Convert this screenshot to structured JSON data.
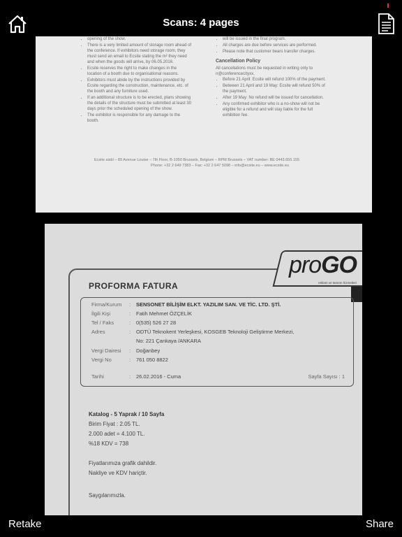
{
  "header": {
    "title": "Scans: 4 pages",
    "home_icon": "home-icon",
    "document_icon": "document-icon"
  },
  "footer": {
    "retake_label": "Retake",
    "share_label": "Share"
  },
  "page1": {
    "left_items": [
      "opening of the show.",
      "There is a very limited amount of storage room ahead of the conference. If exhibitors need storage room, they must send an email to Ecsite stating the m² they need and when the goods will arrive, by 06.05.2016.",
      "Ecsite reserves the right to make changes in the location of a booth due to organisational reasons.",
      "Exhibitors must abide by the instructions provided by Ecsite regarding the construction, maintenance, etc. of the booth and any furniture used.",
      "If an additional structure is to be erected, plans showing the details of the structure must be submitted at least 30 days prior the scheduled opening of the show.",
      "The exhibitor is responsible for any damage to the booth."
    ],
    "right_items_top": [
      "will be issued in the final program.",
      "All charges are due before services are performed.",
      "Please note that customer bears transfer charges."
    ],
    "cancellation_heading": "Cancellation Policy",
    "cancellation_intro": "All cancellations must be requested in writing only to n@conferencecityxx.",
    "cancellation_items": [
      "Before 21 April: Ecsite will refund 100% of the payment.",
      "Between 21 April and 19 May: Ecsite will refund 50% of the payment.",
      "After 19 May: No refund will be issued for cancellation.",
      "Any confirmed exhibitor who is a no-show will not be eligible for a refund and will stay liable for the full exhibition fee."
    ],
    "footer_line1": "Ecsite aisbl – 89 Avenue Louise – 7th Floor, B-1050 Brussels, Belgium – RPM Brussels – VAT number: BE 0443.655.155",
    "footer_line2": "Phone: +32 2 649 7383 – Fax: +32 2 647 5098 – info@ecsite.eu – www.ecsite.eu"
  },
  "page2": {
    "logo_text_a": "pro",
    "logo_text_b": "GO",
    "logo_tagline": "reklam ve tanıtım hizmetleri",
    "title": "PROFORMA FATURA",
    "fields": {
      "firma_label": "Firma/Kurum",
      "firma_value": "SENSONET BİLİŞİM ELKT. YAZILIM SAN. VE TİC. LTD. ŞTİ.",
      "ilgili_label": "İlgili Kişi",
      "ilgili_value": "Fatih Mehmet ÖZÇELİK",
      "tel_label": "Tel / Faks",
      "tel_value": "0(535) 526 27 28",
      "adres_label": "Adres",
      "adres_value1": "ODTÜ Teknokent Yerleşkesi, KOSGEB Teknoloji Geliştirme Merkezi,",
      "adres_value2": "No: 221 Çankaya /ANKARA",
      "vd_label": "Vergi Dairesi",
      "vd_value": "Doğanbey",
      "vn_label": "Vergi No",
      "vn_value": "761 050 8822",
      "tarih_label": "Tarihi",
      "tarih_value": "26.02.2016 - Cuma",
      "sayfa": "Sayfa Sayısı : 1",
      "colon": ":"
    },
    "body": {
      "katalog": "Katalog - 5 Yaprak / 10 Sayfa",
      "birim": "Birim Fiyat : 2.05 TL.",
      "adet": "2.000 adet  = 4.100 TL.",
      "kdv": "%18 KDV = 738",
      "grafik": "Fiyatlarımıza grafik dahildir.",
      "nakliye": "Nakliye ve KDV hariçtir.",
      "saygilar": "Saygılarımızla."
    }
  }
}
